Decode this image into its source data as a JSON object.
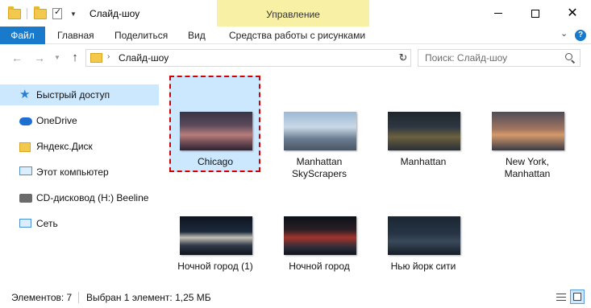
{
  "window": {
    "title": "Слайд-шоу",
    "context_tab": "Управление"
  },
  "ribbon": {
    "tabs": [
      "Файл",
      "Главная",
      "Поделиться",
      "Вид",
      "Средства работы с рисунками"
    ]
  },
  "address": {
    "path": "Слайд-шоу",
    "search_placeholder": "Поиск: Слайд-шоу"
  },
  "navigation": {
    "items": [
      {
        "label": "Быстрый доступ",
        "icon": "star-icon",
        "selected": true
      },
      {
        "label": "OneDrive",
        "icon": "cloud-icon",
        "selected": false
      },
      {
        "label": "Яндекс.Диск",
        "icon": "yandex-disk-icon",
        "selected": false
      },
      {
        "label": "Этот компьютер",
        "icon": "computer-icon",
        "selected": false
      },
      {
        "label": "CD-дисковод (H:) Beeline",
        "icon": "cd-drive-icon",
        "selected": false
      },
      {
        "label": "Сеть",
        "icon": "network-icon",
        "selected": false
      }
    ]
  },
  "files": [
    {
      "name": "Chicago",
      "selected": true
    },
    {
      "name": "Manhattan SkyScrapers",
      "selected": false
    },
    {
      "name": "Manhattan",
      "selected": false
    },
    {
      "name": "New York, Manhattan",
      "selected": false
    },
    {
      "name": "Ночной город (1)",
      "selected": false
    },
    {
      "name": "Ночной город",
      "selected": false
    },
    {
      "name": "Нью йорк сити",
      "selected": false
    }
  ],
  "status": {
    "count": "Элементов: 7",
    "selection": "Выбран 1 элемент: 1,25 МБ"
  },
  "colors": {
    "accent": "#1979ca",
    "selection_bg": "#cce8ff",
    "context_tab_bg": "#f8f1a5",
    "highlight_border": "#d40000"
  }
}
